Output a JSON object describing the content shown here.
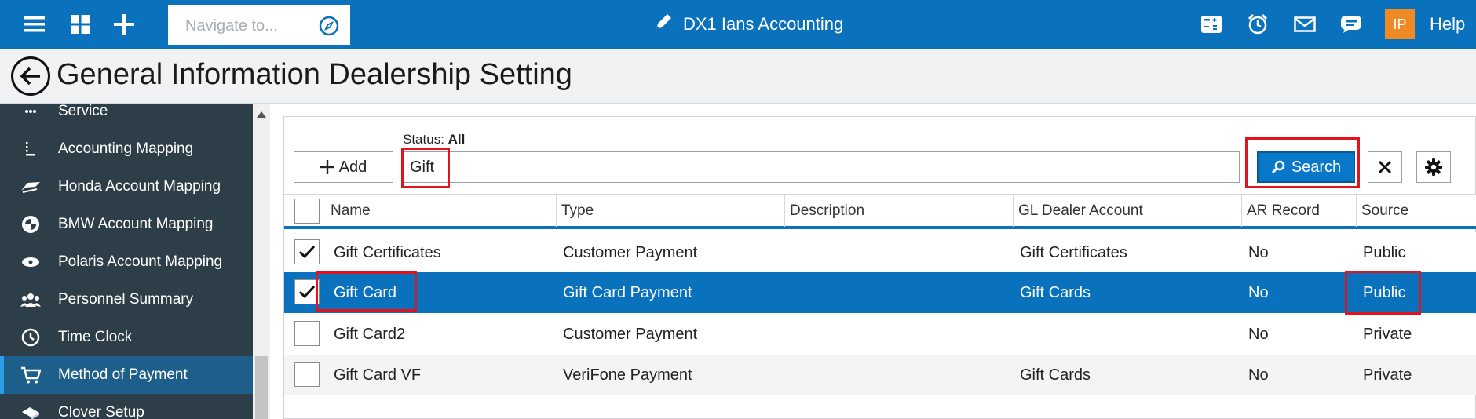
{
  "topbar": {
    "navigate_placeholder": "Navigate to...",
    "app_title": "DX1 Ians Accounting",
    "avatar_initials": "IP",
    "help_label": "Help",
    "icons": [
      "menu-icon",
      "dashboard-icon",
      "plus-icon",
      "compass-icon",
      "pencil-icon",
      "calculator-icon",
      "alarm-clock-icon",
      "mail-icon",
      "chat-icon"
    ],
    "color": "#0a72bd"
  },
  "page": {
    "title": "General Information Dealership Setting"
  },
  "sidebar": {
    "items": [
      {
        "label": "Service",
        "icon": "dots-icon"
      },
      {
        "label": "Accounting Mapping",
        "icon": "mapping-icon"
      },
      {
        "label": "Honda Account Mapping",
        "icon": "honda-logo-icon"
      },
      {
        "label": "BMW Account Mapping",
        "icon": "bmw-logo-icon"
      },
      {
        "label": "Polaris Account Mapping",
        "icon": "polaris-logo-icon"
      },
      {
        "label": "Personnel Summary",
        "icon": "people-icon"
      },
      {
        "label": "Time Clock",
        "icon": "clock-icon"
      },
      {
        "label": "Method of Payment",
        "icon": "cart-icon",
        "active": true
      },
      {
        "label": "Clover Setup",
        "icon": "clover-icon"
      }
    ],
    "active_color": "#1d5e8a"
  },
  "toolbar": {
    "status_label": "Status:",
    "status_value": "All",
    "add_label": "Add",
    "search_value": "Gift",
    "search_label": "Search"
  },
  "grid": {
    "columns": [
      "Name",
      "Type",
      "Description",
      "GL Dealer Account",
      "AR Record",
      "Source"
    ],
    "rows": [
      {
        "checked": true,
        "name": "Gift Certificates",
        "type": "Customer Payment",
        "description": "",
        "gl_account": "Gift Certificates",
        "ar_record": "No",
        "source": "Public",
        "selected": false
      },
      {
        "checked": true,
        "name": "Gift Card",
        "type": "Gift Card Payment",
        "description": "",
        "gl_account": "Gift Cards",
        "ar_record": "No",
        "source": "Public",
        "selected": true
      },
      {
        "checked": false,
        "name": "Gift Card2",
        "type": "Customer Payment",
        "description": "",
        "gl_account": "",
        "ar_record": "No",
        "source": "Private",
        "selected": false
      },
      {
        "checked": false,
        "name": "Gift Card VF",
        "type": "VeriFone Payment",
        "description": "",
        "gl_account": "Gift Cards",
        "ar_record": "No",
        "source": "Private",
        "selected": false
      }
    ]
  },
  "highlight_color": "#e0141e"
}
